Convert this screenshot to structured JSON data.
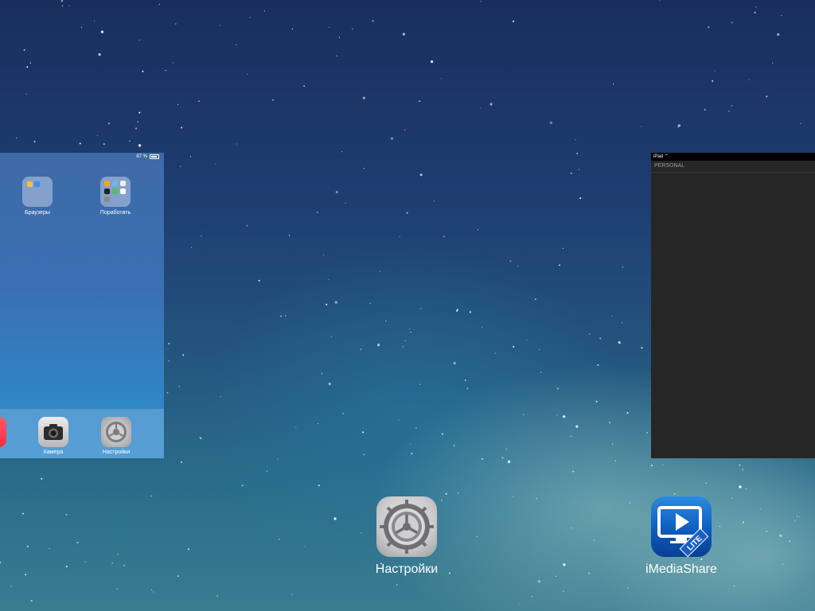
{
  "left_card": {
    "status": {
      "battery_text": "87 %"
    },
    "folders": [
      {
        "label": "Браузеры",
        "icon": "browsers-folder-icon"
      },
      {
        "label": "Поработать",
        "icon": "work-folder-icon"
      }
    ],
    "dock": [
      {
        "label": "",
        "icon": "red-app-icon"
      },
      {
        "label": "Камера",
        "icon": "camera-icon"
      },
      {
        "label": "Настройки",
        "icon": "settings-icon"
      }
    ]
  },
  "right_card": {
    "device": "iPad",
    "section_header": "PERSONAL",
    "background": "#262626"
  },
  "switcher_apps": [
    {
      "label": "Настройки",
      "icon": "settings-icon"
    },
    {
      "label": "iMediaShare",
      "icon": "imediashare-lite-icon",
      "badge": "LITE"
    }
  ]
}
